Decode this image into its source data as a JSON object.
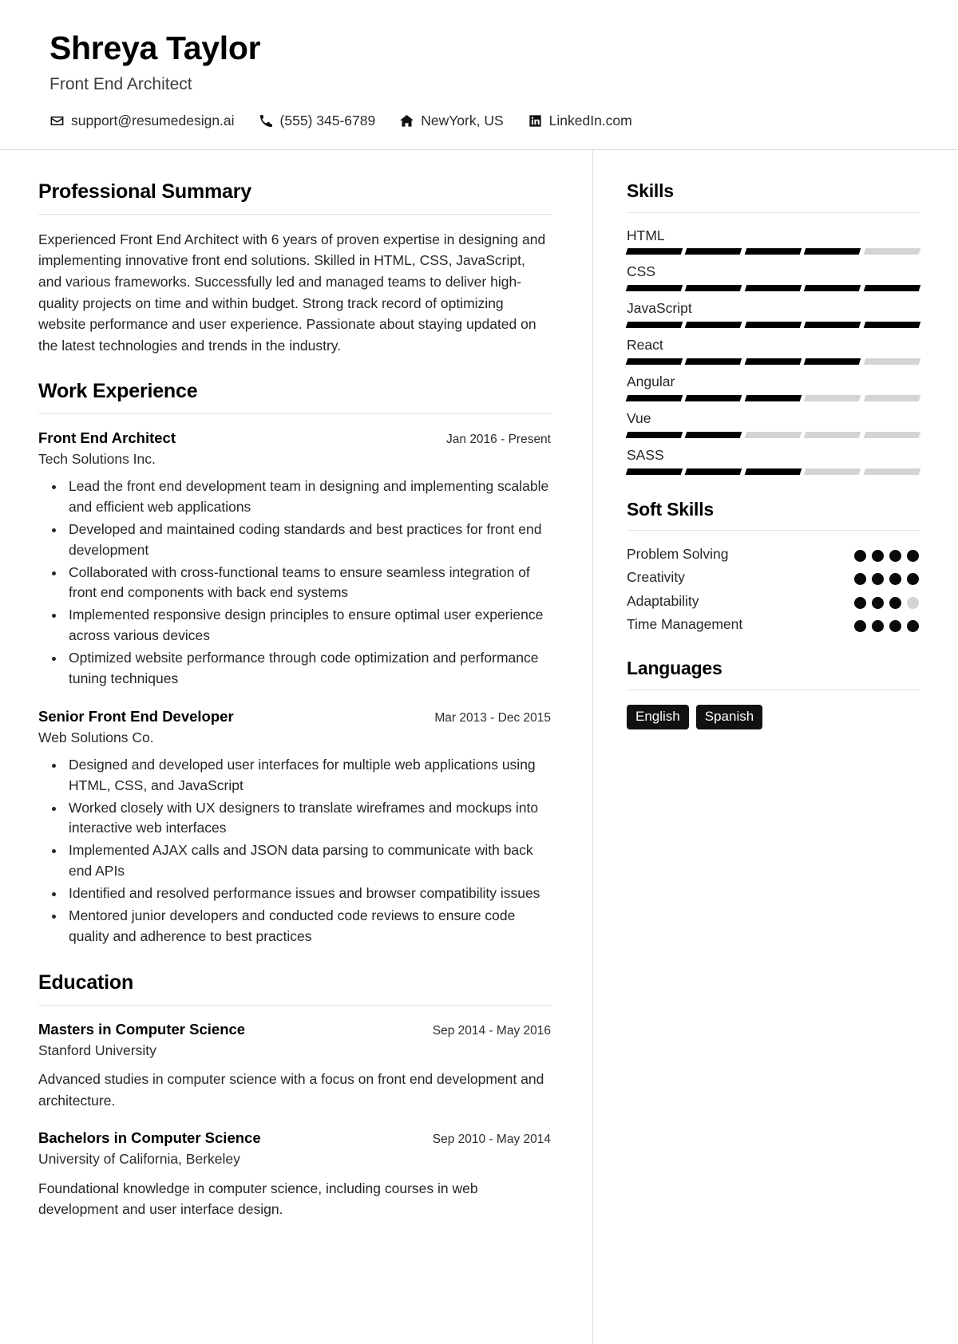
{
  "header": {
    "name": "Shreya Taylor",
    "headline": "Front End Architect",
    "contacts": [
      {
        "icon": "envelope-icon",
        "text": "support@resumedesign.ai"
      },
      {
        "icon": "phone-icon",
        "text": "(555) 345-6789"
      },
      {
        "icon": "home-icon",
        "text": "NewYork, US"
      },
      {
        "icon": "linkedin-icon",
        "text": "LinkedIn.com"
      }
    ]
  },
  "main": {
    "summary": {
      "title": "Professional Summary",
      "text": "Experienced Front End Architect with 6 years of proven expertise in designing and implementing innovative front end solutions. Skilled in HTML, CSS, JavaScript, and various frameworks. Successfully led and managed teams to deliver high-quality projects on time and within budget. Strong track record of optimizing website performance and user experience. Passionate about staying updated on the latest technologies and trends in the industry."
    },
    "experience": {
      "title": "Work Experience",
      "entries": [
        {
          "role": "Front End Architect",
          "org": "Tech Solutions Inc.",
          "date": "Jan 2016 - Present",
          "bullets": [
            "Lead the front end development team in designing and implementing scalable and efficient web applications",
            "Developed and maintained coding standards and best practices for front end development",
            "Collaborated with cross-functional teams to ensure seamless integration of front end components with back end systems",
            "Implemented responsive design principles to ensure optimal user experience across various devices",
            "Optimized website performance through code optimization and performance tuning techniques"
          ]
        },
        {
          "role": "Senior Front End Developer",
          "org": "Web Solutions Co.",
          "date": "Mar 2013 - Dec 2015",
          "bullets": [
            "Designed and developed user interfaces for multiple web applications using HTML, CSS, and JavaScript",
            "Worked closely with UX designers to translate wireframes and mockups into interactive web interfaces",
            "Implemented AJAX calls and JSON data parsing to communicate with back end APIs",
            "Identified and resolved performance issues and browser compatibility issues",
            "Mentored junior developers and conducted code reviews to ensure code quality and adherence to best practices"
          ]
        }
      ]
    },
    "education": {
      "title": "Education",
      "entries": [
        {
          "degree": "Masters in Computer Science",
          "school": "Stanford University",
          "date": "Sep 2014 - May 2016",
          "desc": "Advanced studies in computer science with a focus on front end development and architecture."
        },
        {
          "degree": "Bachelors in Computer Science",
          "school": "University of California, Berkeley",
          "date": "Sep 2010 - May 2014",
          "desc": "Foundational knowledge in computer science, including courses in web development and user interface design."
        }
      ]
    }
  },
  "sidebar": {
    "skills": {
      "title": "Skills",
      "segments_total": 5,
      "items": [
        {
          "name": "HTML",
          "level": 4
        },
        {
          "name": "CSS",
          "level": 5
        },
        {
          "name": "JavaScript",
          "level": 5
        },
        {
          "name": "React",
          "level": 4
        },
        {
          "name": "Angular",
          "level": 3
        },
        {
          "name": "Vue",
          "level": 2
        },
        {
          "name": "SASS",
          "level": 3
        }
      ]
    },
    "soft_skills": {
      "title": "Soft Skills",
      "dots_total": 4,
      "items": [
        {
          "name": "Problem Solving",
          "level": 4
        },
        {
          "name": "Creativity",
          "level": 4
        },
        {
          "name": "Adaptability",
          "level": 3
        },
        {
          "name": "Time Management",
          "level": 4
        }
      ]
    },
    "languages": {
      "title": "Languages",
      "items": [
        "English",
        "Spanish"
      ]
    }
  },
  "colors": {
    "accent": "#000000",
    "muted": "#d4d4d4",
    "rule": "#e2e2e2"
  }
}
